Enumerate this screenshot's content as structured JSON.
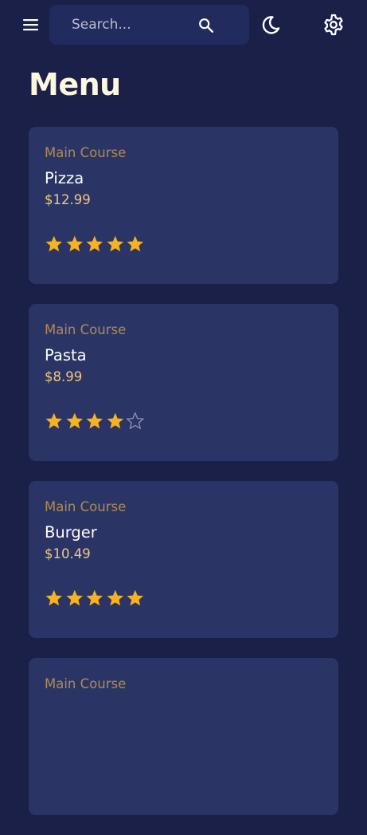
{
  "header": {
    "search_placeholder": "Search..."
  },
  "page_title": "Menu",
  "colors": {
    "background": "#1a2048",
    "card": "#2b3565",
    "search_bg": "#222b5e",
    "category": "#b08a52",
    "price": "#f1c77d",
    "star_filled": "#f7b21f",
    "star_empty": "#8a90b0"
  },
  "icons": {
    "menu": "hamburger-icon",
    "search": "search-icon",
    "theme": "moon-icon",
    "settings": "gear-icon",
    "star": "star-icon"
  },
  "items": [
    {
      "category": "Main Course",
      "name": "Pizza",
      "price": "$12.99",
      "rating": 5
    },
    {
      "category": "Main Course",
      "name": "Pasta",
      "price": "$8.99",
      "rating": 4
    },
    {
      "category": "Main Course",
      "name": "Burger",
      "price": "$10.49",
      "rating": 5
    },
    {
      "category": "Main Course"
    }
  ]
}
